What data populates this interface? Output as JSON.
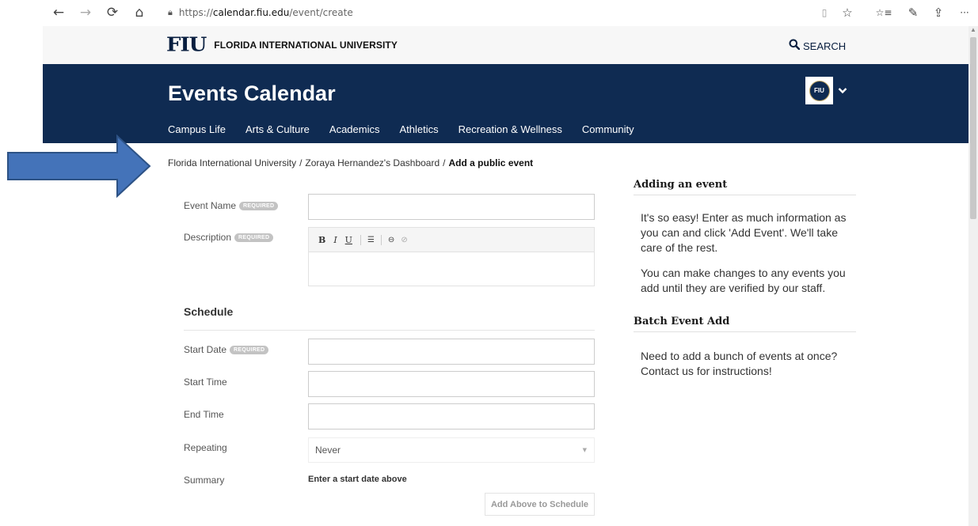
{
  "browser": {
    "back_icon": "←",
    "forward_icon": "→",
    "refresh_icon": "⟳",
    "home_icon": "⌂",
    "url_prefix": "https://",
    "url_domain": "calendar.fiu.edu",
    "url_path": "/event/create",
    "reading_icon": "▯",
    "favorite_icon": "☆",
    "favorites_bar_icon": "☆≡",
    "notes_icon": "✎",
    "share_icon": "⇪",
    "more_icon": "···"
  },
  "header": {
    "logo_text": "FIU",
    "university_name": "FLORIDA INTERNATIONAL UNIVERSITY",
    "search_label": "SEARCH"
  },
  "banner": {
    "title": "Events Calendar",
    "avatar_text": "FIU",
    "nav": [
      "Campus Life",
      "Arts & Culture",
      "Academics",
      "Athletics",
      "Recreation & Wellness",
      "Community"
    ]
  },
  "breadcrumb": {
    "items": [
      "Florida International University",
      "Zoraya Hernandez's Dashboard"
    ],
    "current": "Add a public event",
    "separator": "/"
  },
  "form": {
    "required_badge": "REQUIRED",
    "event_name_label": "Event Name",
    "event_name_value": "",
    "description_label": "Description",
    "schedule_title": "Schedule",
    "start_date_label": "Start Date",
    "start_time_label": "Start Time",
    "end_time_label": "End Time",
    "repeating_label": "Repeating",
    "repeating_value": "Never",
    "summary_label": "Summary",
    "summary_value": "Enter a start date above",
    "add_schedule_button": "Add Above to Schedule"
  },
  "editor_toolbar": {
    "bold": "B",
    "italic": "I",
    "underline": "U",
    "list": "☰",
    "link": "⊖",
    "unlink": "⊘"
  },
  "sidebar": {
    "adding_heading": "Adding an event",
    "adding_p1": "It's so easy! Enter as much information as you can and click 'Add Event'. We'll take care of the rest.",
    "adding_p2": "You can make changes to any events you add until they are verified by our staff.",
    "batch_heading": "Batch Event Add",
    "batch_p": "Need to add a bunch of events at once? Contact us for instructions!"
  },
  "colors": {
    "banner_blue": "#0f2b52",
    "arrow_blue": "#4473b9",
    "arrow_outline": "#2d5285"
  }
}
